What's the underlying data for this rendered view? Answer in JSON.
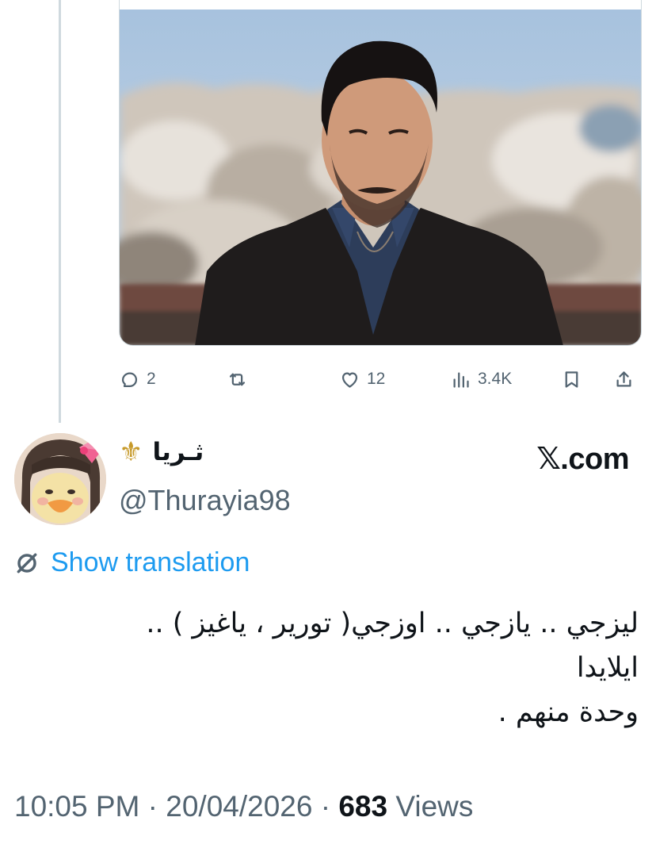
{
  "tweet_actions": {
    "replies": "2",
    "likes": "12",
    "views": "3.4K"
  },
  "author": {
    "display_name": "ثـريا",
    "badge_glyph": "⚜",
    "handle": "@Thurayia98",
    "avatar_icon": "duck-with-pink-bow-avatar"
  },
  "brand": "𝕏.com",
  "translate": {
    "label": "Show translation",
    "icon": "globe-icon"
  },
  "tweet": {
    "lines": [
      "ليزجي .. يازجي .. اوزجي( تورير ، ياغيز )  ..",
      "ايلايدا",
      "وحدة منهم ."
    ]
  },
  "meta": {
    "time": "10:05 PM",
    "separator": "·",
    "date": "20/04/2026",
    "views_count": "683",
    "views_label": "Views"
  },
  "colors": {
    "accent": "#1d9bf0",
    "secondary_text": "#536471",
    "primary_text": "#0f1419",
    "border": "#cfd9de"
  }
}
